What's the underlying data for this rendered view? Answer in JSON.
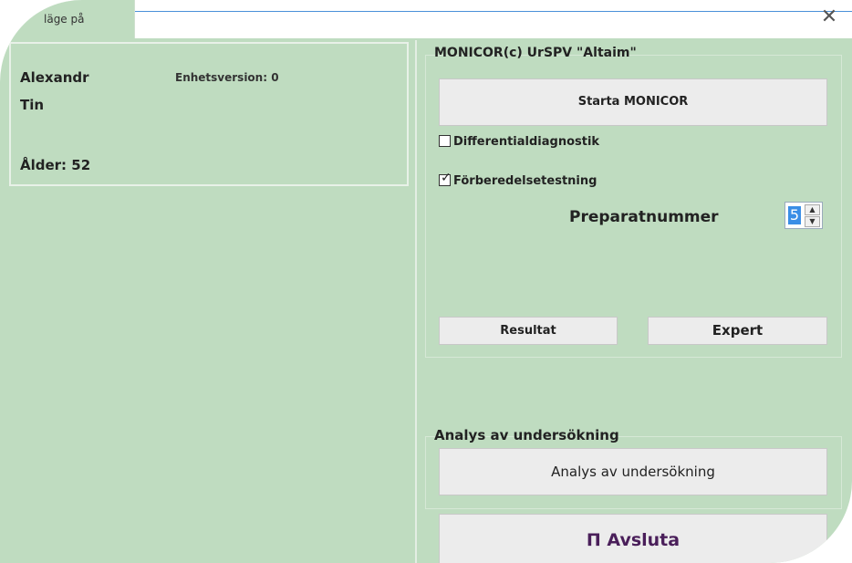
{
  "window": {
    "title": "läge på",
    "close_glyph": "✕"
  },
  "patient": {
    "first_name": "Alexandr",
    "last_name": "Tin",
    "age_label": "Ålder: 52",
    "device_version": "Enhetsversion: 0"
  },
  "monicor": {
    "group_title": "MONICOR(c) UrSPV \"Altaim\"",
    "start_button": "Starta MONICOR",
    "differential": {
      "label": "Differentialdiagnostik",
      "checked": false
    },
    "preparation": {
      "label": "Förberedelsetestning",
      "checked": true
    },
    "preparation_number_label": "Preparatnummer",
    "preparation_number": "5",
    "result_button": "Resultat",
    "expert_button": "Expert"
  },
  "analysis": {
    "group_title": "Analys av undersökning",
    "button": "Analys av undersökning"
  },
  "exit": {
    "icon_glyph": "Π",
    "label": "Avsluta"
  },
  "colors": {
    "background": "#bfdcc0",
    "button": "#ececec",
    "accent": "#3a8ee6",
    "exit_text": "#4a1f5a"
  }
}
